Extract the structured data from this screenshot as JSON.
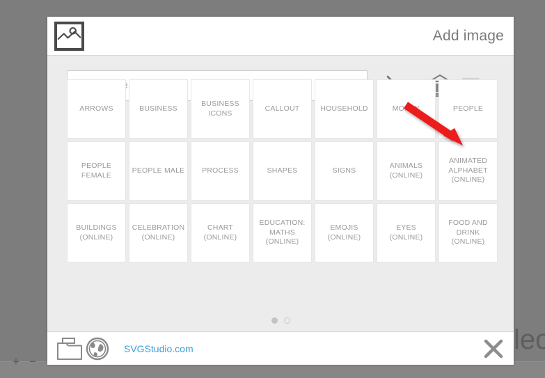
{
  "background": {
    "right_edge_text": "leo",
    "zoom_in_label": "+",
    "zoom_out_label": "−"
  },
  "dialog": {
    "title": "Add image",
    "app_icon": "image-icon",
    "search": {
      "placeholder": "Keyword, e.g. money",
      "value": "",
      "submit_icon": "chevron-right-icon"
    },
    "header_icons": [
      {
        "name": "library-icon",
        "label": "Library"
      },
      {
        "name": "recent-images-icon",
        "label": "Recent"
      }
    ],
    "categories": [
      [
        {
          "label": "ARROWS"
        },
        {
          "label": "BUSINESS"
        },
        {
          "label": "BUSINESS\nICONS"
        },
        {
          "label": "CALLOUT"
        },
        {
          "label": "HOUSEHOLD"
        },
        {
          "label": "MONEY"
        },
        {
          "label": "PEOPLE"
        }
      ],
      [
        {
          "label": "PEOPLE\nFEMALE"
        },
        {
          "label": "PEOPLE MALE"
        },
        {
          "label": "PROCESS"
        },
        {
          "label": "SHAPES"
        },
        {
          "label": "SIGNS"
        },
        {
          "label": "ANIMALS\n(ONLINE)"
        },
        {
          "label": "ANIMATED\nALPHABET\n(ONLINE)"
        }
      ],
      [
        {
          "label": "BUILDINGS\n(ONLINE)"
        },
        {
          "label": "CELEBRATION\n(ONLINE)"
        },
        {
          "label": "CHART\n(ONLINE)"
        },
        {
          "label": "EDUCATION:\nMATHS\n(ONLINE)"
        },
        {
          "label": "EMOJIS\n(ONLINE)"
        },
        {
          "label": "EYES (ONLINE)"
        },
        {
          "label": "FOOD AND\nDRINK (ONLINE)"
        }
      ]
    ],
    "pagination": {
      "pages": 2,
      "active": 1
    },
    "footer": {
      "folder_icon": "folder-icon",
      "globe_icon": "globe-icon",
      "link_text": "SVGStudio.com",
      "close_icon": "close-icon"
    }
  },
  "annotation": {
    "arrow_color": "#ec1c1c",
    "points_to": "PEOPLE"
  },
  "colors": {
    "desktop": "#7d7d7d",
    "dialog_bg": "#ececec",
    "panel_white": "#ffffff",
    "tile_text": "#9a9a9a",
    "link": "#3aa0d8",
    "icon_dark": "#6e6e6e",
    "icon_light": "#d6d6d6"
  }
}
